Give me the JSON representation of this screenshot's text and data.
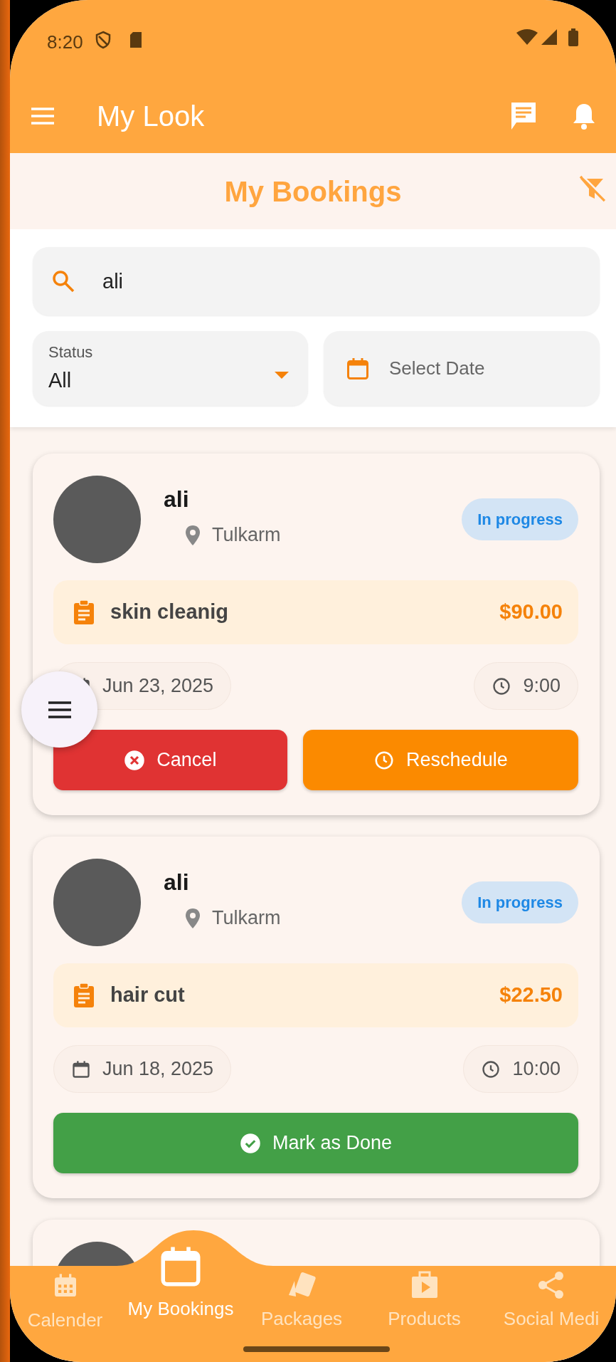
{
  "status_bar": {
    "time": "8:20"
  },
  "app_bar": {
    "title": "My Look"
  },
  "header": {
    "title": "My Bookings"
  },
  "search": {
    "value": "ali"
  },
  "filters": {
    "status": {
      "label": "Status",
      "value": "All"
    },
    "date": {
      "placeholder": "Select Date"
    }
  },
  "bookings": [
    {
      "name": "ali",
      "location": "Tulkarm",
      "status": "In progress",
      "service": "skin cleanig",
      "price": "$90.00",
      "date": "Jun 23, 2025",
      "time": "9:00",
      "actions": [
        {
          "kind": "cancel",
          "label": "Cancel"
        },
        {
          "kind": "reschedule",
          "label": "Reschedule"
        }
      ]
    },
    {
      "name": "ali",
      "location": "Tulkarm",
      "status": "In progress",
      "service": "hair cut",
      "price": "$22.50",
      "date": "Jun 18, 2025",
      "time": "10:00",
      "actions": [
        {
          "kind": "done",
          "label": "Mark as Done"
        }
      ]
    }
  ],
  "more_below": true,
  "nav": [
    {
      "kind": "calendar",
      "label": "Calender",
      "selected": false
    },
    {
      "kind": "bookings",
      "label": "My Bookings",
      "selected": true
    },
    {
      "kind": "packages",
      "label": "Packages",
      "selected": false
    },
    {
      "kind": "products",
      "label": "Products",
      "selected": false
    },
    {
      "kind": "social",
      "label": "Social Medi",
      "selected": false
    }
  ]
}
